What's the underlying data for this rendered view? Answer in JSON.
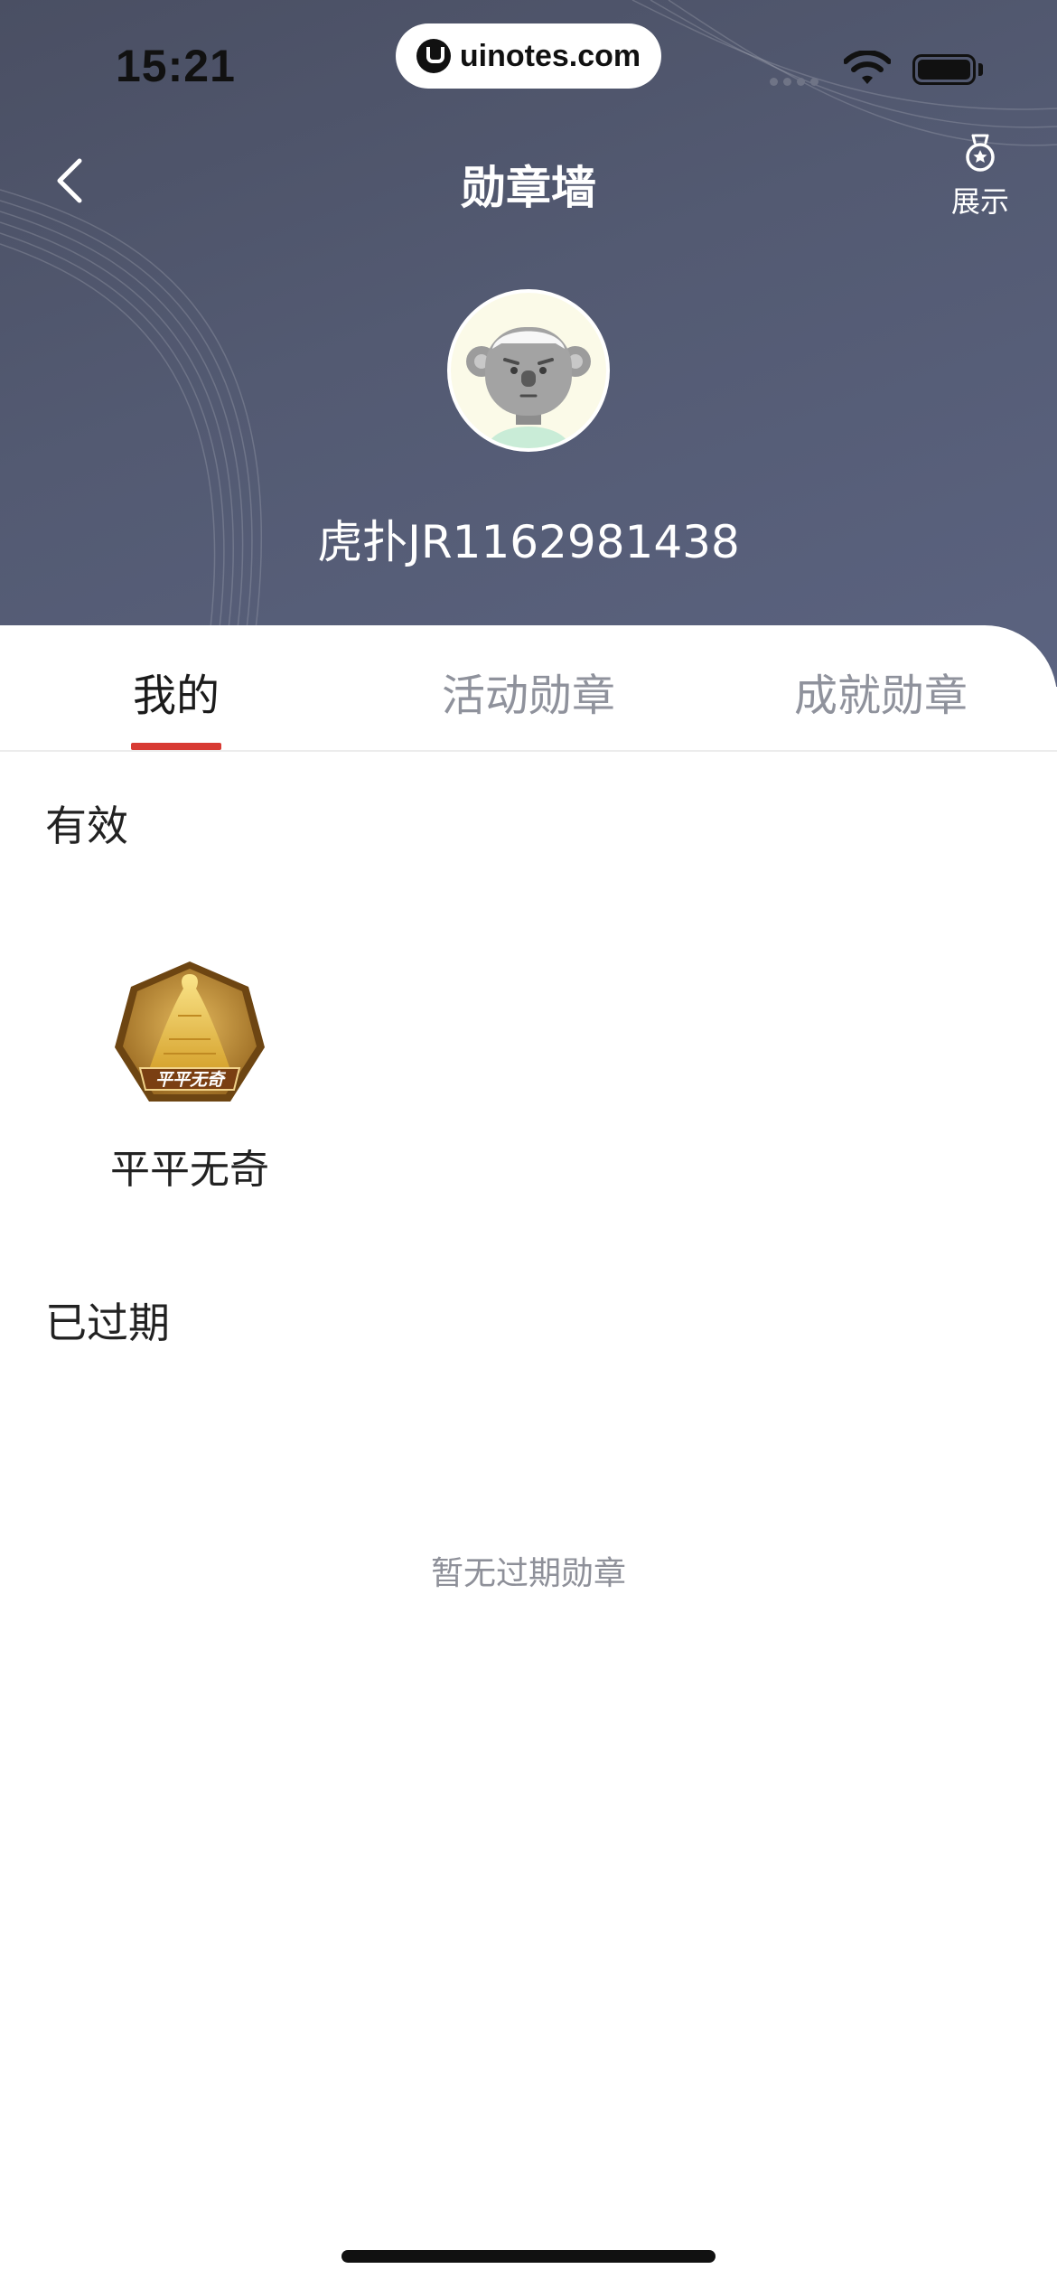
{
  "status_bar": {
    "time": "15:21",
    "url": "uinotes.com"
  },
  "nav": {
    "title": "勋章墙",
    "showcase_label": "展示"
  },
  "profile": {
    "username": "虎扑JR1162981438"
  },
  "tabs": [
    {
      "label": "我的",
      "active": true
    },
    {
      "label": "活动勋章",
      "active": false
    },
    {
      "label": "成就勋章",
      "active": false
    }
  ],
  "sections": {
    "valid": {
      "title": "有效",
      "badges": [
        {
          "name": "平平无奇",
          "emblem_text": "平平无奇"
        }
      ]
    },
    "expired": {
      "title": "已过期",
      "empty_text": "暂无过期勋章"
    }
  },
  "colors": {
    "header_bg": "#535a72",
    "accent": "#d83a33",
    "tab_inactive": "#8f929c"
  }
}
